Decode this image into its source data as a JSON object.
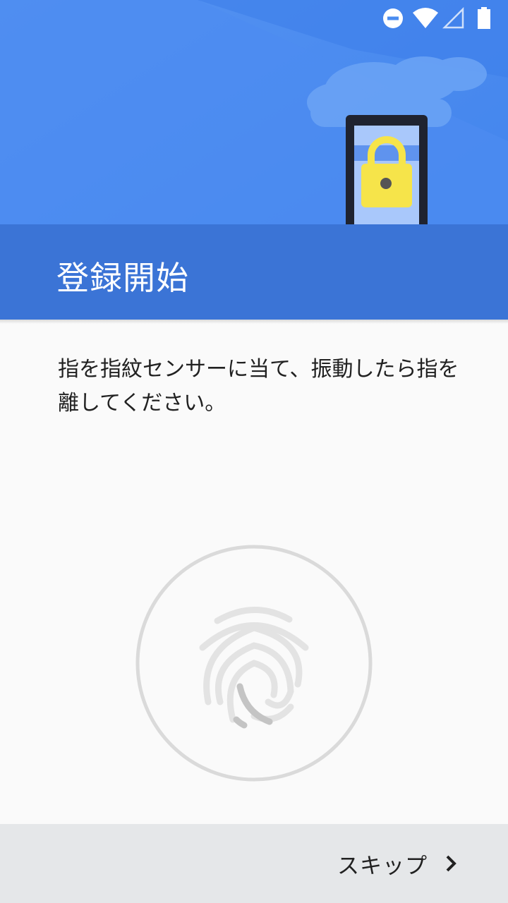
{
  "header": {
    "title": "登録開始"
  },
  "status_bar": {
    "icons": [
      "do-not-disturb-icon",
      "wifi-icon",
      "cellular-signal-icon",
      "battery-icon"
    ]
  },
  "main": {
    "instruction": "指を指紋センサーに当て、振動したら指を離してください。"
  },
  "footer": {
    "skip_label": "スキップ"
  },
  "colors": {
    "header_blue": "#4a8cf0",
    "title_band": "#3b74d6",
    "lock_yellow": "#f6e44a",
    "fingerprint_gray": "#cfcfcf"
  }
}
